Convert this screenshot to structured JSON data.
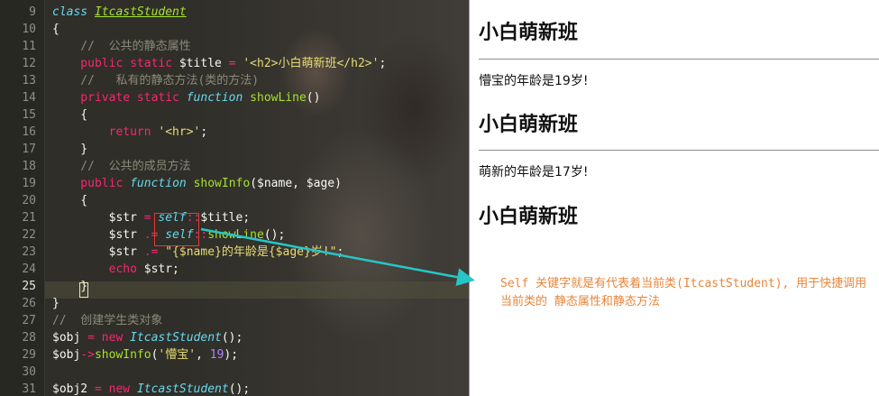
{
  "editor": {
    "lines": [
      {
        "n": "9",
        "tokens": [
          {
            "c": "kwi",
            "t": "class"
          },
          {
            "c": "",
            "t": " "
          },
          {
            "c": "cls",
            "t": "ItcastStudent"
          }
        ]
      },
      {
        "n": "10",
        "tokens": [
          {
            "c": "",
            "t": "{"
          }
        ]
      },
      {
        "n": "11",
        "tokens": [
          {
            "c": "cm",
            "t": "    //  公共的静态属性"
          }
        ]
      },
      {
        "n": "12",
        "tokens": [
          {
            "c": "kw",
            "t": "    public static"
          },
          {
            "c": "",
            "t": " $title "
          },
          {
            "c": "op",
            "t": "="
          },
          {
            "c": "",
            "t": " "
          },
          {
            "c": "str",
            "t": "'<h2>小白萌新班</h2>'"
          },
          {
            "c": "",
            "t": ";"
          }
        ]
      },
      {
        "n": "13",
        "tokens": [
          {
            "c": "cm",
            "t": "    //   私有的静态方法(类的方法)"
          }
        ]
      },
      {
        "n": "14",
        "tokens": [
          {
            "c": "kw",
            "t": "    private static"
          },
          {
            "c": "",
            "t": " "
          },
          {
            "c": "kwi",
            "t": "function"
          },
          {
            "c": "",
            "t": " "
          },
          {
            "c": "fn",
            "t": "showLine"
          },
          {
            "c": "",
            "t": "()"
          }
        ]
      },
      {
        "n": "15",
        "tokens": [
          {
            "c": "",
            "t": "    {"
          }
        ]
      },
      {
        "n": "16",
        "tokens": [
          {
            "c": "kw",
            "t": "        return"
          },
          {
            "c": "",
            "t": " "
          },
          {
            "c": "str",
            "t": "'<hr>'"
          },
          {
            "c": "",
            "t": ";"
          }
        ]
      },
      {
        "n": "17",
        "tokens": [
          {
            "c": "",
            "t": "    }"
          }
        ]
      },
      {
        "n": "18",
        "tokens": [
          {
            "c": "cm",
            "t": "    //  公共的成员方法"
          }
        ]
      },
      {
        "n": "19",
        "tokens": [
          {
            "c": "kw",
            "t": "    public"
          },
          {
            "c": "",
            "t": " "
          },
          {
            "c": "kwi",
            "t": "function"
          },
          {
            "c": "",
            "t": " "
          },
          {
            "c": "fn",
            "t": "showInfo"
          },
          {
            "c": "",
            "t": "($name, $age)"
          }
        ]
      },
      {
        "n": "20",
        "tokens": [
          {
            "c": "",
            "t": "    {"
          }
        ]
      },
      {
        "n": "21",
        "tokens": [
          {
            "c": "",
            "t": "        $str "
          },
          {
            "c": "op",
            "t": "="
          },
          {
            "c": "",
            "t": " "
          },
          {
            "c": "clsi",
            "t": "self"
          },
          {
            "c": "op",
            "t": "::"
          },
          {
            "c": "",
            "t": "$title;"
          }
        ]
      },
      {
        "n": "22",
        "tokens": [
          {
            "c": "",
            "t": "        $str "
          },
          {
            "c": "op",
            "t": ".="
          },
          {
            "c": "",
            "t": " "
          },
          {
            "c": "clsi",
            "t": "self"
          },
          {
            "c": "op",
            "t": "::"
          },
          {
            "c": "fn",
            "t": "showLine"
          },
          {
            "c": "",
            "t": "();"
          }
        ]
      },
      {
        "n": "23",
        "tokens": [
          {
            "c": "",
            "t": "        $str "
          },
          {
            "c": "op",
            "t": ".="
          },
          {
            "c": "",
            "t": " "
          },
          {
            "c": "str",
            "t": "\"{$name}的年龄是{$age}岁!\""
          },
          {
            "c": "",
            "t": ";"
          }
        ]
      },
      {
        "n": "24",
        "tokens": [
          {
            "c": "kw",
            "t": "        echo"
          },
          {
            "c": "",
            "t": " $str;"
          }
        ]
      },
      {
        "n": "25",
        "tokens": [
          {
            "c": "",
            "t": "    }"
          }
        ],
        "current": true
      },
      {
        "n": "26",
        "tokens": [
          {
            "c": "",
            "t": "}"
          }
        ]
      },
      {
        "n": "27",
        "tokens": [
          {
            "c": "cm",
            "t": "//  创建学生类对象"
          }
        ]
      },
      {
        "n": "28",
        "tokens": [
          {
            "c": "",
            "t": "$obj "
          },
          {
            "c": "op",
            "t": "="
          },
          {
            "c": "",
            "t": " "
          },
          {
            "c": "kw",
            "t": "new"
          },
          {
            "c": "",
            "t": " "
          },
          {
            "c": "clsi",
            "t": "ItcastStudent"
          },
          {
            "c": "",
            "t": "();"
          }
        ]
      },
      {
        "n": "29",
        "tokens": [
          {
            "c": "",
            "t": "$obj"
          },
          {
            "c": "op",
            "t": "->"
          },
          {
            "c": "fn",
            "t": "showInfo"
          },
          {
            "c": "",
            "t": "("
          },
          {
            "c": "str",
            "t": "'懵宝'"
          },
          {
            "c": "",
            "t": ", "
          },
          {
            "c": "num",
            "t": "19"
          },
          {
            "c": "",
            "t": ");"
          }
        ]
      },
      {
        "n": "30",
        "tokens": [
          {
            "c": "",
            "t": ""
          }
        ]
      },
      {
        "n": "31",
        "tokens": [
          {
            "c": "",
            "t": "$obj2 "
          },
          {
            "c": "op",
            "t": "="
          },
          {
            "c": "",
            "t": " "
          },
          {
            "c": "kw",
            "t": "new"
          },
          {
            "c": "",
            "t": " "
          },
          {
            "c": "clsi",
            "t": "ItcastStudent"
          },
          {
            "c": "",
            "t": "();"
          }
        ]
      }
    ]
  },
  "output": {
    "heading_1": "小白萌新班",
    "text_1": "懵宝的年龄是19岁!",
    "heading_2": "小白萌新班",
    "text_2": "萌新的年龄是17岁!",
    "heading_3": "小白萌新班"
  },
  "annotation": {
    "text": "Self 关键字就是有代表着当前类(ItcastStudent), 用于快捷调用当前类的 静态属性和静态方法"
  },
  "colors": {
    "editor_bg": "#2f2e29",
    "keyword": "#f92672",
    "function": "#a6e22e",
    "string": "#e6db74",
    "comment": "#8c8a78",
    "highlight_box": "#e53935",
    "arrow": "#26c6c6",
    "note": "#e8853a"
  }
}
